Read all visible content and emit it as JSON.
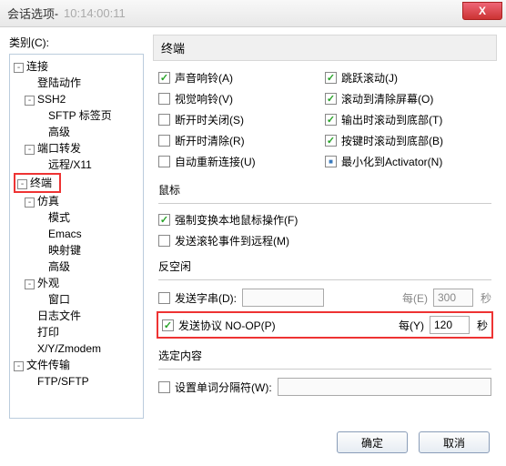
{
  "title": "会话选项",
  "title_meta": "10:14:00:11",
  "category_label": "类别(C):",
  "tree": {
    "n0": "连接",
    "n0_0": "登陆动作",
    "n0_1": "SSH2",
    "n0_1_0": "SFTP 标签页",
    "n0_1_1": "高级",
    "n0_2": "端口转发",
    "n0_2_0": "远程/X11",
    "n1": "终端",
    "n1_0": "仿真",
    "n1_0_0": "模式",
    "n1_0_1": "Emacs",
    "n1_0_2": "映射键",
    "n1_0_3": "高级",
    "n1_1": "外观",
    "n1_1_0": "窗口",
    "n1_2": "日志文件",
    "n1_3": "打印",
    "n1_4": "X/Y/Zmodem",
    "n2": "文件传输",
    "n2_0": "FTP/SFTP"
  },
  "panel": {
    "title": "终端",
    "opts": {
      "a": "声音响铃(A)",
      "j": "跳跃滚动(J)",
      "v": "视觉响铃(V)",
      "o": "滚动到清除屏幕(O)",
      "s": "断开时关闭(S)",
      "t": "输出时滚动到底部(T)",
      "r": "断开时清除(R)",
      "b": "按键时滚动到底部(B)",
      "u": "自动重新连接(U)",
      "n": "最小化到Activator(N)"
    },
    "mouse": {
      "label": "鼠标",
      "f": "强制变换本地鼠标操作(F)",
      "m": "发送滚轮事件到远程(M)"
    },
    "idle": {
      "label": "反空闲",
      "sendstr": "发送字串(D):",
      "every_e": "每(E)",
      "sec": "秒",
      "sec_val": "300",
      "proto": "发送协议 NO-OP(P)",
      "every_y": "每(Y)",
      "y_val": "120"
    },
    "sel": {
      "label": "选定内容",
      "w": "设置单词分隔符(W):"
    }
  },
  "buttons": {
    "ok": "确定",
    "cancel": "取消"
  }
}
